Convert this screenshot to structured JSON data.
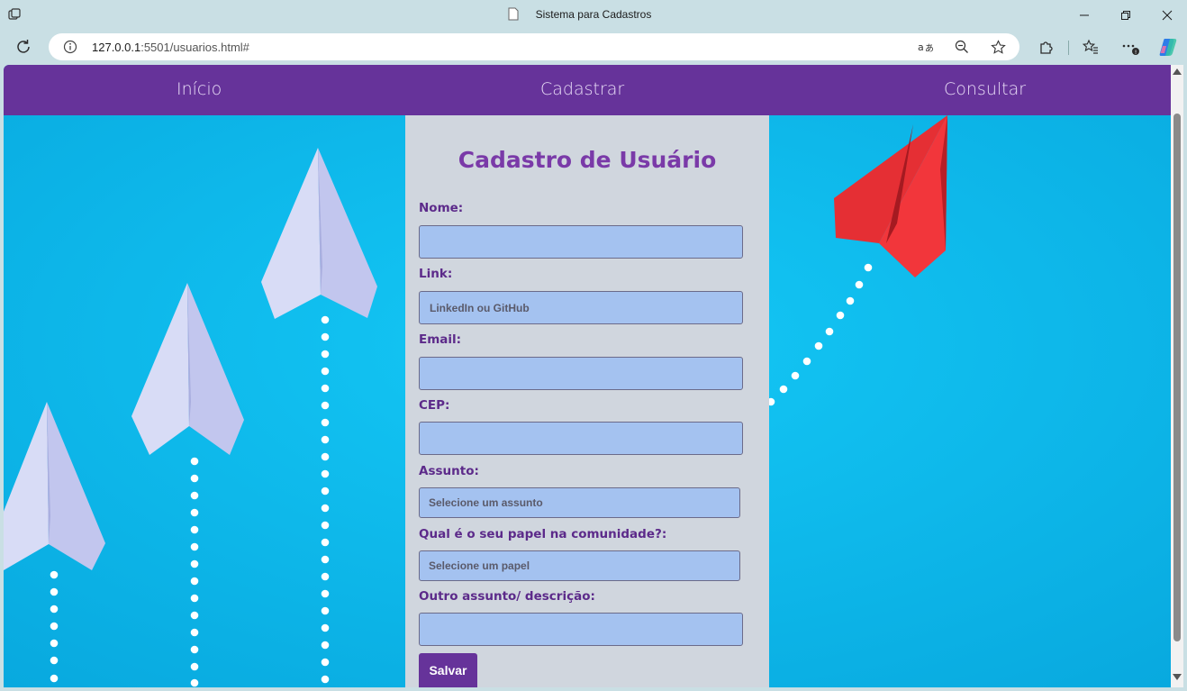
{
  "browser": {
    "tab_title": "Sistema para Cadastros",
    "url_host": "127.0.0.1",
    "url_path": ":5501/usuarios.html#"
  },
  "nav": {
    "items": [
      {
        "label": "Início"
      },
      {
        "label": "Cadastrar"
      },
      {
        "label": "Consultar"
      }
    ]
  },
  "form": {
    "title": "Cadastro de Usuário",
    "fields": {
      "nome": {
        "label": "Nome:",
        "value": "",
        "placeholder": ""
      },
      "link": {
        "label": "Link:",
        "value": "",
        "placeholder": "LinkedIn ou GitHub"
      },
      "email": {
        "label": "Email:",
        "value": "",
        "placeholder": ""
      },
      "cep": {
        "label": "CEP:",
        "value": "",
        "placeholder": ""
      },
      "assunto": {
        "label": "Assunto:",
        "selected": "Selecione um assunto"
      },
      "papel": {
        "label": "Qual é o seu papel na comunidade?:",
        "selected": "Selecione um papel"
      },
      "descricao": {
        "label": "Outro assunto/ descrição:",
        "value": "",
        "placeholder": ""
      }
    },
    "save_label": "Salvar"
  },
  "colors": {
    "nav_bg": "#66339a",
    "title": "#7a3aa8",
    "label": "#5c2a8a",
    "input_bg": "#a4c2f0",
    "panel_bg": "#d0d6de",
    "page_bg": "#1ab5e8"
  }
}
